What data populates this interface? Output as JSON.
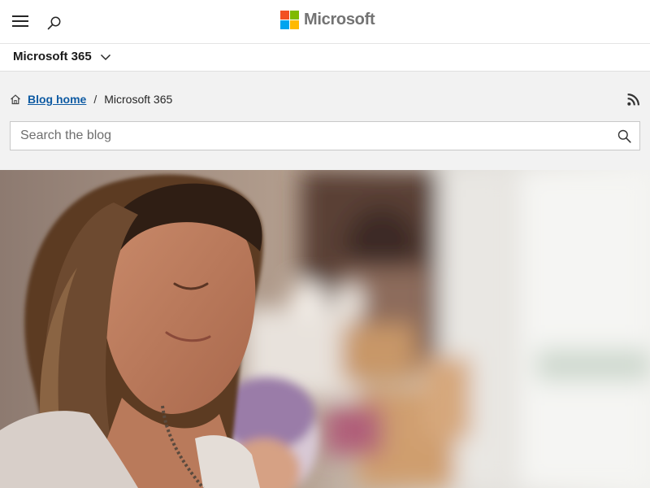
{
  "header": {
    "menu_icon": "hamburger-menu-icon",
    "search_icon": "search-icon",
    "brand_name": "Microsoft",
    "brand_colors": {
      "red": "#f25022",
      "green": "#7fba00",
      "blue": "#00a4ef",
      "yellow": "#ffb900"
    }
  },
  "product_bar": {
    "name": "Microsoft 365",
    "chevron_icon": "chevron-down-icon"
  },
  "breadcrumb": {
    "home_icon": "home-icon",
    "home_label": "Blog home",
    "separator": "/",
    "current": "Microsoft 365"
  },
  "rss_icon": "rss-icon",
  "search": {
    "placeholder": "Search the blog",
    "value": "",
    "submit_icon": "search-icon"
  },
  "colors": {
    "link": "#0f5ba3",
    "band_background": "#f2f2f2"
  }
}
